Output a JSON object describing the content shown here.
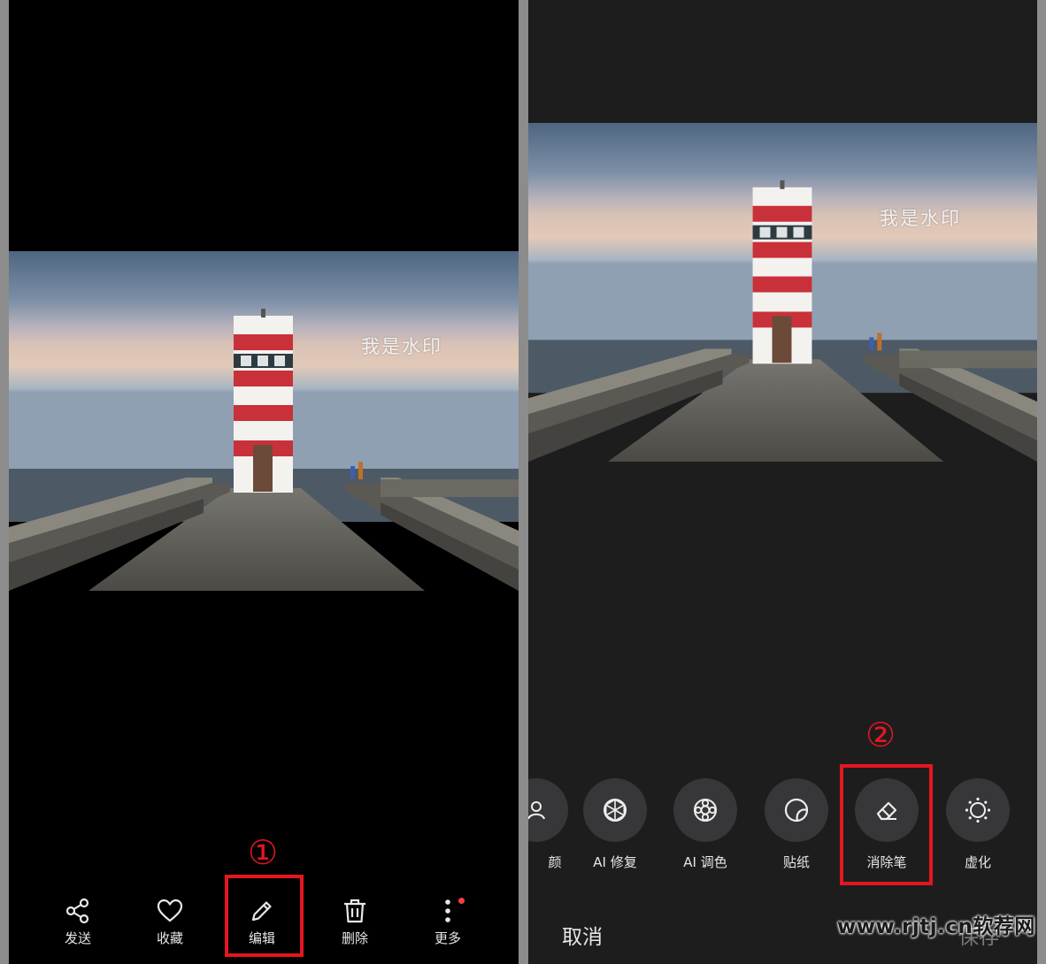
{
  "photo": {
    "watermark_text": "我是水印"
  },
  "left_panel": {
    "toolbar": [
      {
        "name": "share",
        "label": "发送",
        "icon": "share-icon"
      },
      {
        "name": "favorite",
        "label": "收藏",
        "icon": "heart-icon"
      },
      {
        "name": "edit",
        "label": "编辑",
        "icon": "pencil-icon"
      },
      {
        "name": "delete",
        "label": "删除",
        "icon": "trash-icon"
      },
      {
        "name": "more",
        "label": "更多",
        "icon": "more-vertical-icon"
      }
    ],
    "step_marker": "①"
  },
  "right_panel": {
    "tools": [
      {
        "name": "beauty-partial",
        "label": "颜",
        "icon": "beauty-icon"
      },
      {
        "name": "ai-repair",
        "label": "AI 修复",
        "icon": "aperture-icon"
      },
      {
        "name": "ai-color",
        "label": "AI 调色",
        "icon": "palette-wheel-icon"
      },
      {
        "name": "sticker",
        "label": "贴纸",
        "icon": "sticker-icon"
      },
      {
        "name": "eraser",
        "label": "消除笔",
        "icon": "eraser-icon"
      },
      {
        "name": "blur",
        "label": "虚化",
        "icon": "blur-icon"
      }
    ],
    "step_marker": "②",
    "cancel_label": "取消",
    "save_label": "保存"
  },
  "site_watermark": "www.rjtj.cn软荐网",
  "colors": {
    "highlight": "#e5161f",
    "notification_dot": "#ff3a48"
  }
}
